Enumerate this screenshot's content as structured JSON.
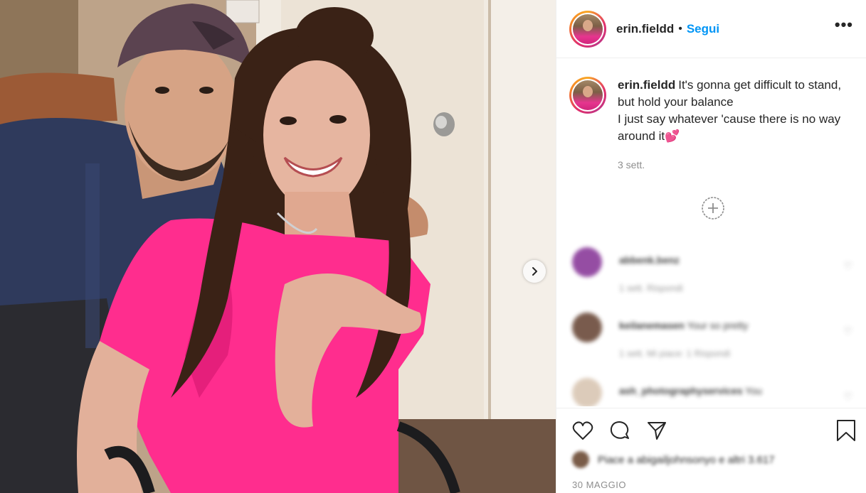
{
  "post": {
    "username": "erin.fieldd",
    "separator": "•",
    "follow_label": "Segui",
    "more_label": "•••",
    "caption_username": "erin.fieldd",
    "caption_line1": "It's gonna get difficult to stand, but hold your balance",
    "caption_line2": "I just say whatever 'cause there is no way around it💕",
    "caption_time": "3 sett.",
    "date": "30 MAGGIO"
  },
  "comments": [
    {
      "user": "abbenk.benz",
      "text": "",
      "meta": "1 sett.   Rispondi",
      "avatar_color": "#8a3a9a"
    },
    {
      "user": "keilanemasen",
      "text": "Your so pretty",
      "meta": "1 sett.   Mi piace: 1   Rispondi",
      "avatar_color": "#6b4a3a"
    },
    {
      "user": "ash_photographyservices",
      "text": "You",
      "meta": "",
      "avatar_color": "#d9c6b3"
    }
  ],
  "likes_text": "Piace a abigailjohnsonyo e altri 3.617",
  "icons": {
    "next": "chevron-right-icon",
    "load_more": "plus-circle-icon",
    "like": "heart-icon",
    "comment": "comment-icon",
    "share": "share-icon",
    "save": "bookmark-icon"
  },
  "colors": {
    "follow": "#0095f6",
    "muted": "#8e8e8e",
    "text": "#262626",
    "shirt": "#ff2d8e"
  }
}
